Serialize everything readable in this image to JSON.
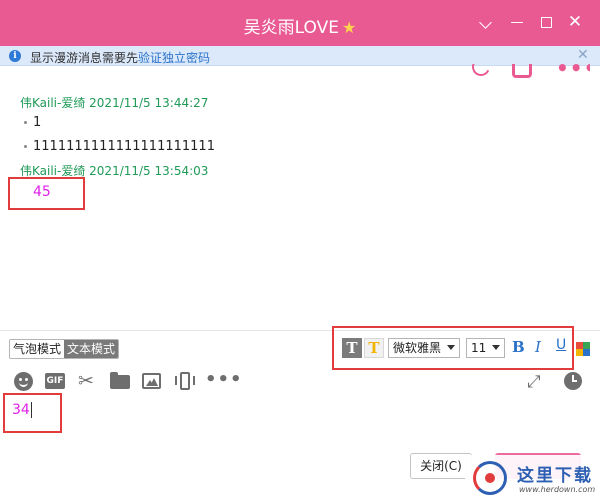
{
  "window": {
    "title": "吴炎雨LOVE",
    "title_badge": "★"
  },
  "infobar": {
    "text": "显示漫游消息需要先",
    "link": "验证独立密码"
  },
  "messages": [
    {
      "meta": "伟Kaili-爱绮 2021/11/5 13:44:27",
      "lines": [
        "1",
        "1111111111111111111111"
      ]
    },
    {
      "meta": "伟Kaili-爱绮 2021/11/5 13:54:03",
      "lines": [
        "45"
      ]
    }
  ],
  "toolbar": {
    "mode_bubble": "气泡模式",
    "mode_text": "文本模式",
    "font_family": "微软雅黑",
    "font_size": "11",
    "bold": "B",
    "italic": "I",
    "underline": "U",
    "icons": [
      "emoji-icon",
      "gif-icon",
      "scissors-icon",
      "folder-icon",
      "image-icon",
      "phone-icon",
      "more-icon",
      "expand-icon",
      "clock-icon"
    ]
  },
  "compose": {
    "value": "34"
  },
  "buttons": {
    "close": "关闭(C)",
    "send": ""
  },
  "watermark": {
    "text": "这里下载",
    "url": "www.herdown.com"
  },
  "colors": {
    "titlebar": "#e95a93",
    "meta": "#1f9a57",
    "colored_text": "#e020e8",
    "highlight_box": "#e23b3b",
    "link": "#2a72c9"
  }
}
